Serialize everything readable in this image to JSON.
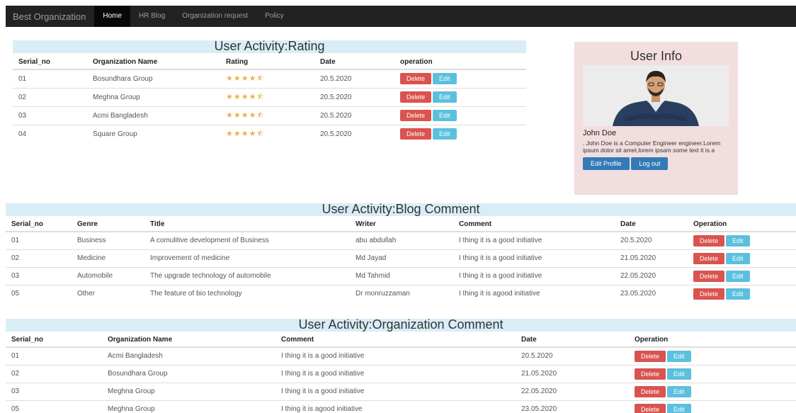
{
  "navbar": {
    "brand": "Best Organization",
    "items": [
      {
        "label": "Home",
        "active": true
      },
      {
        "label": "HR Blog",
        "active": false
      },
      {
        "label": "Organization request",
        "active": false
      },
      {
        "label": "Policy",
        "active": false
      }
    ]
  },
  "rating": {
    "title": "User Activity:Rating",
    "headers": [
      "Serial_no",
      "Organization Name",
      "Rating",
      "Date",
      "operation"
    ],
    "rows": [
      {
        "serial": "01",
        "org": "Bosundhara Group",
        "rating": 4.5,
        "date": "20.5.2020"
      },
      {
        "serial": "02",
        "org": "Meghna Group",
        "rating": 4.5,
        "date": "20.5.2020"
      },
      {
        "serial": "03",
        "org": "Acmi Bangladesh",
        "rating": 4.5,
        "date": "20.5.2020"
      },
      {
        "serial": "04",
        "org": "Square Group",
        "rating": 4.5,
        "date": "20.5.2020"
      }
    ],
    "delete_label": "Delete",
    "edit_label": "Edit"
  },
  "user_info": {
    "title": "User Info",
    "name": "John Doe",
    "bio": ". John Doe is a Computer Engineer engineer.Lorem ipsum dolor sit amet,lorem ipsam some text it is a",
    "edit_profile_label": "Edit Profile",
    "logout_label": "Log out"
  },
  "blog_comment": {
    "title": "User Activity:Blog Comment",
    "headers": [
      "Serial_no",
      "Genre",
      "Title",
      "Writer",
      "Comment",
      "Date",
      "Operation"
    ],
    "rows": [
      {
        "serial": "01",
        "genre": "Business",
        "title": "A comulitive development of Business",
        "writer": "abu abdullah",
        "comment": "I thing it is a good initiative",
        "date": "20.5.2020"
      },
      {
        "serial": "02",
        "genre": "Medicine",
        "title": "Improvement of medicine",
        "writer": "Md Jayad",
        "comment": "I thing it is a good initiative",
        "date": "21.05.2020"
      },
      {
        "serial": "03",
        "genre": "Automobile",
        "title": "The upgrade technology of automobile",
        "writer": "Md Tahmid",
        "comment": "I thing it is a good initiative",
        "date": "22.05.2020"
      },
      {
        "serial": "05",
        "genre": "Other",
        "title": "The feature of bio technology",
        "writer": "Dr monruzzaman",
        "comment": "I thing it is agood initiative",
        "date": "23.05.2020"
      }
    ],
    "delete_label": "Delete",
    "edit_label": "Edit"
  },
  "org_comment": {
    "title": "User Activity:Organization Comment",
    "headers": [
      "Serial_no",
      "Organization Name",
      "Comment",
      "Date",
      "Operation"
    ],
    "rows": [
      {
        "serial": "01",
        "org": "Acmi Bangladesh",
        "comment": "I thing it is a good initiative",
        "date": "20.5.2020"
      },
      {
        "serial": "02",
        "org": "Bosundhara Group",
        "comment": "I thing it is a good initiative",
        "date": "21.05.2020"
      },
      {
        "serial": "03",
        "org": "Meghna Group",
        "comment": "I thing it is a good initiative",
        "date": "22.05.2020"
      },
      {
        "serial": "05",
        "org": "Meghna Group",
        "comment": "I thing it is agood initiative",
        "date": "23.05.2020"
      }
    ],
    "delete_label": "Delete",
    "edit_label": "Edit"
  },
  "colors": {
    "navbar_bg": "#222222",
    "section_title_bg": "#d9edf7",
    "card_bg": "#f2dede",
    "delete": "#d9534f",
    "edit": "#5bc0de",
    "primary": "#337ab7",
    "star": "#f0ad4e"
  }
}
